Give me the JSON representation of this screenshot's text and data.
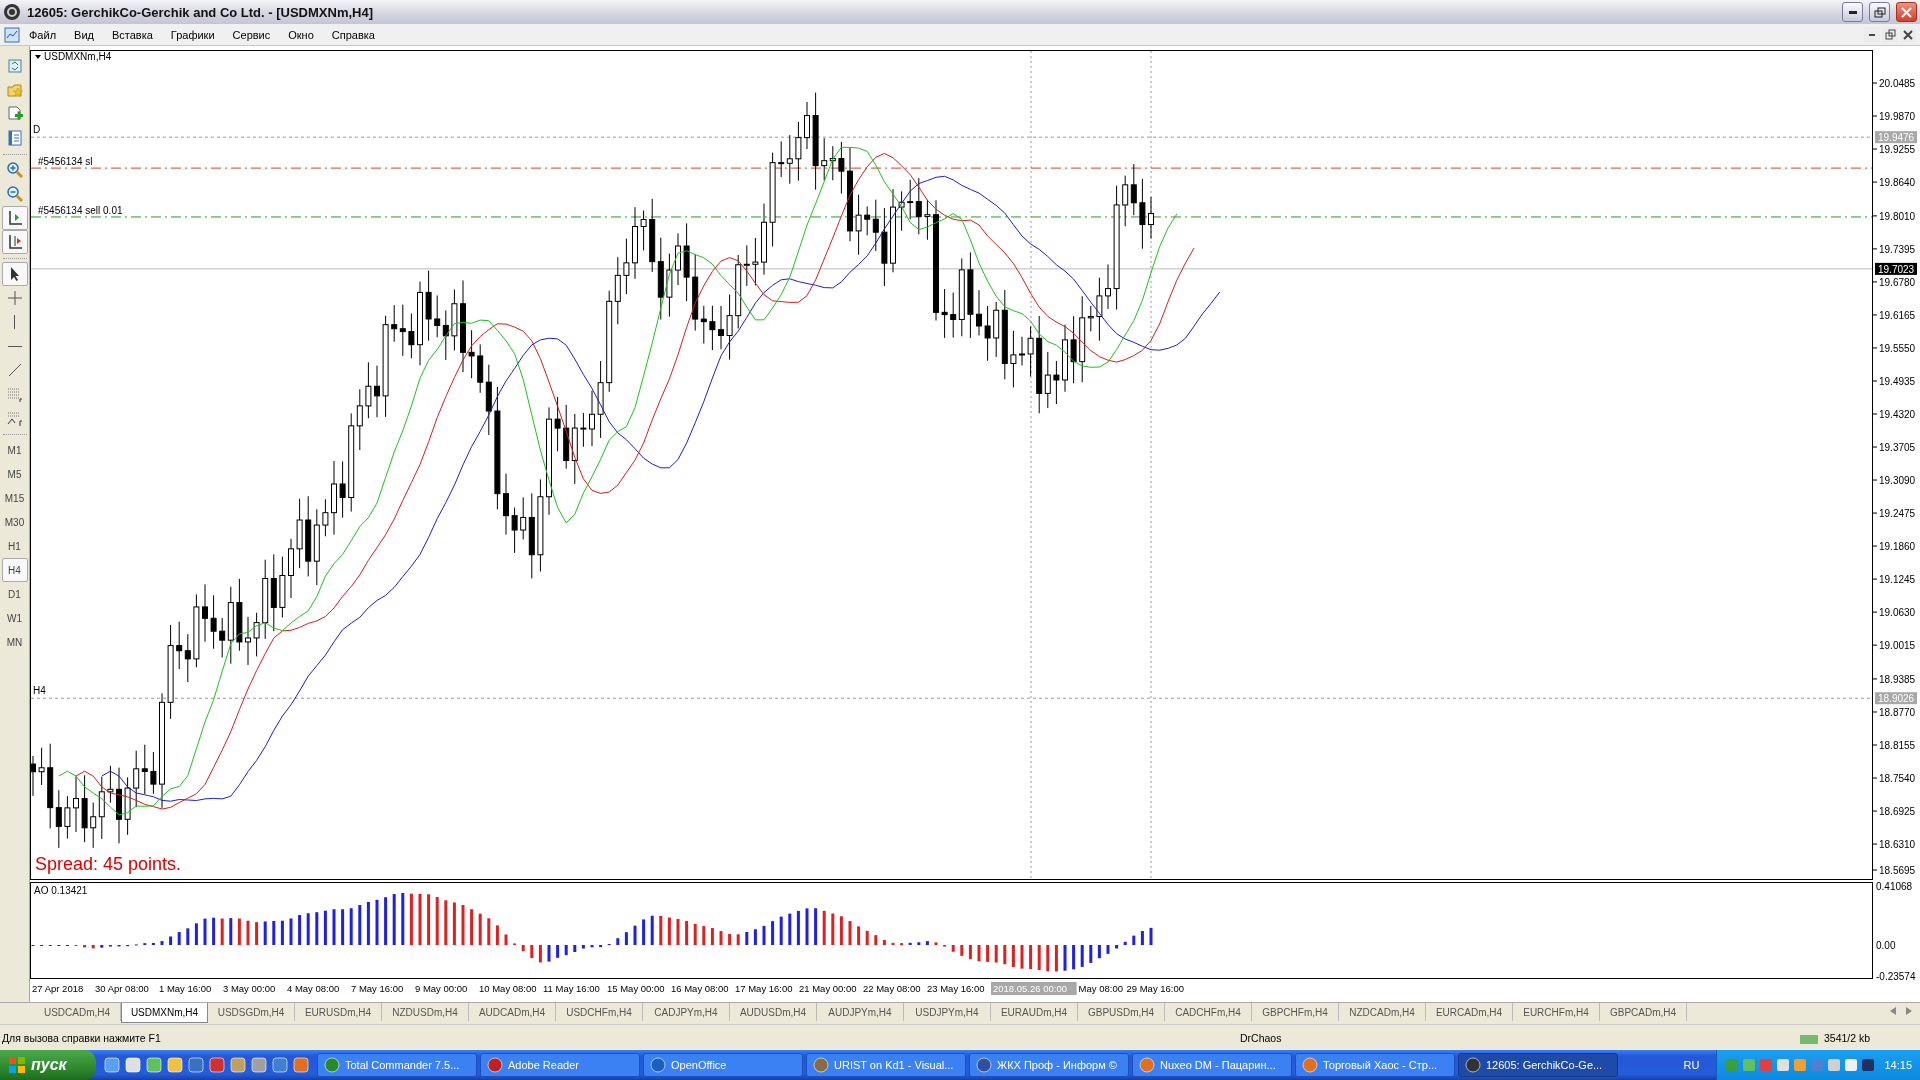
{
  "window": {
    "title": "12605: GerchikCo-Gerchik and Co Ltd. - [USDMXNm,H4]"
  },
  "menu": [
    "Файл",
    "Вид",
    "Вставка",
    "Графики",
    "Сервис",
    "Окно",
    "Справка"
  ],
  "toolbar": {
    "tools": [
      {
        "kind": "profiles",
        "selected": false
      },
      {
        "kind": "templates",
        "selected": false
      },
      {
        "kind": "new-order",
        "selected": false
      },
      {
        "kind": "navigator",
        "selected": false
      },
      {
        "kind": "zoom-in",
        "selected": false
      },
      {
        "kind": "zoom-out",
        "selected": false
      },
      {
        "kind": "shift",
        "selected": true
      },
      {
        "kind": "autoscroll",
        "selected": true
      },
      {
        "kind": "cursor",
        "selected": true
      },
      {
        "kind": "crosshair",
        "selected": false
      },
      {
        "kind": "vline",
        "selected": false
      },
      {
        "kind": "hline",
        "selected": false
      },
      {
        "kind": "trendline",
        "selected": false
      },
      {
        "kind": "fibo",
        "selected": false
      },
      {
        "kind": "fibo-fan",
        "selected": false
      }
    ],
    "timeframes": [
      {
        "label": "M1",
        "selected": false
      },
      {
        "label": "M5",
        "selected": false
      },
      {
        "label": "M15",
        "selected": false
      },
      {
        "label": "M30",
        "selected": false
      },
      {
        "label": "H1",
        "selected": false
      },
      {
        "label": "H4",
        "selected": true
      },
      {
        "label": "D1",
        "selected": false
      },
      {
        "label": "W1",
        "selected": false
      },
      {
        "label": "MN",
        "selected": false
      }
    ]
  },
  "chart": {
    "symbol": "USDMXNm,H4",
    "price_ticks": [
      "20.0485",
      "19.9870",
      "19.9255",
      "19.8640",
      "19.8010",
      "19.7395",
      "19.6780",
      "19.6165",
      "19.5550",
      "19.4935",
      "19.4320",
      "19.3705",
      "19.3090",
      "19.2475",
      "19.1860",
      "19.1245",
      "19.0630",
      "19.0015",
      "18.9385",
      "18.8770",
      "18.8155",
      "18.7540",
      "18.6925",
      "18.6310",
      "18.5695"
    ],
    "lines": [
      {
        "kind": "level",
        "label": "D",
        "price": "19.9476"
      },
      {
        "kind": "stop-loss",
        "label": "#5456134 sl"
      },
      {
        "kind": "order",
        "label": "#5456134 sell 0.01"
      },
      {
        "kind": "bid",
        "price": "19.7023"
      },
      {
        "kind": "level",
        "label": "H4",
        "price": "18.9026"
      }
    ],
    "spread": "Spread: 45 points.",
    "indicator": {
      "label": "AO 0.13421",
      "ticks": [
        "0.41068",
        "0.00",
        "-0.23574"
      ]
    },
    "time_labels": [
      {
        "kind": "normal",
        "text": "27 Apr 2018"
      },
      {
        "kind": "normal",
        "text": "30 Apr 08:00"
      },
      {
        "kind": "normal",
        "text": "1 May 16:00"
      },
      {
        "kind": "normal",
        "text": "3 May 00:00"
      },
      {
        "kind": "normal",
        "text": "4 May 08:00"
      },
      {
        "kind": "normal",
        "text": "7 May 16:00"
      },
      {
        "kind": "normal",
        "text": "9 May 00:00"
      },
      {
        "kind": "normal",
        "text": "10 May 08:00"
      },
      {
        "kind": "normal",
        "text": "11 May 16:00"
      },
      {
        "kind": "normal",
        "text": "15 May 00:00"
      },
      {
        "kind": "normal",
        "text": "16 May 08:00"
      },
      {
        "kind": "normal",
        "text": "17 May 16:00"
      },
      {
        "kind": "normal",
        "text": "21 May 00:00"
      },
      {
        "kind": "normal",
        "text": "22 May 08:00"
      },
      {
        "kind": "normal",
        "text": "23 May 16:00"
      },
      {
        "kind": "cursor",
        "text": "2018.05.26 00:00"
      },
      {
        "kind": "normal",
        "text": "May 08:00"
      },
      {
        "kind": "normal",
        "text": "29 May 16:00"
      }
    ]
  },
  "tabs": [
    {
      "label": "USDCADm,H4",
      "selected": false
    },
    {
      "label": "USDMXNm,H4",
      "selected": true
    },
    {
      "label": "USDSGDm,H4",
      "selected": false
    },
    {
      "label": "EURUSDm,H4",
      "selected": false
    },
    {
      "label": "NZDUSDm,H4",
      "selected": false
    },
    {
      "label": "AUDCADm,H4",
      "selected": false
    },
    {
      "label": "USDCHFm,H4",
      "selected": false
    },
    {
      "label": "CADJPYm,H4",
      "selected": false
    },
    {
      "label": "AUDUSDm,H4",
      "selected": false
    },
    {
      "label": "AUDJPYm,H4",
      "selected": false
    },
    {
      "label": "USDJPYm,H4",
      "selected": false
    },
    {
      "label": "EURAUDm,H4",
      "selected": false
    },
    {
      "label": "GBPUSDm,H4",
      "selected": false
    },
    {
      "label": "CADCHFm,H4",
      "selected": false
    },
    {
      "label": "GBPCHFm,H4",
      "selected": false
    },
    {
      "label": "NZDCADm,H4",
      "selected": false
    },
    {
      "label": "EURCADm,H4",
      "selected": false
    },
    {
      "label": "EURCHFm,H4",
      "selected": false
    },
    {
      "label": "GBPCADm,H4",
      "selected": false
    }
  ],
  "status_bar": {
    "help": "Для вызова справки нажмите F1",
    "profile": "DrChaos",
    "traffic": "3541/2 kb"
  },
  "taskbar": {
    "start": "пуск",
    "tasks": [
      {
        "label": "Total Commander 7.5...",
        "selected": false
      },
      {
        "label": "Adobe Reader",
        "selected": false
      },
      {
        "label": "OpenOffice",
        "selected": false
      },
      {
        "label": "URIST on Kd1 - Visual...",
        "selected": false
      },
      {
        "label": "ЖКХ Проф - Информ ©",
        "selected": false
      },
      {
        "label": "Nuxeo DM - Пацарин...",
        "selected": false
      },
      {
        "label": "Торговый Хаос - Стр...",
        "selected": false
      },
      {
        "label": "12605: GerchikCo-Ge...",
        "selected": true
      }
    ],
    "language": "RU",
    "clock": "14:15"
  }
}
